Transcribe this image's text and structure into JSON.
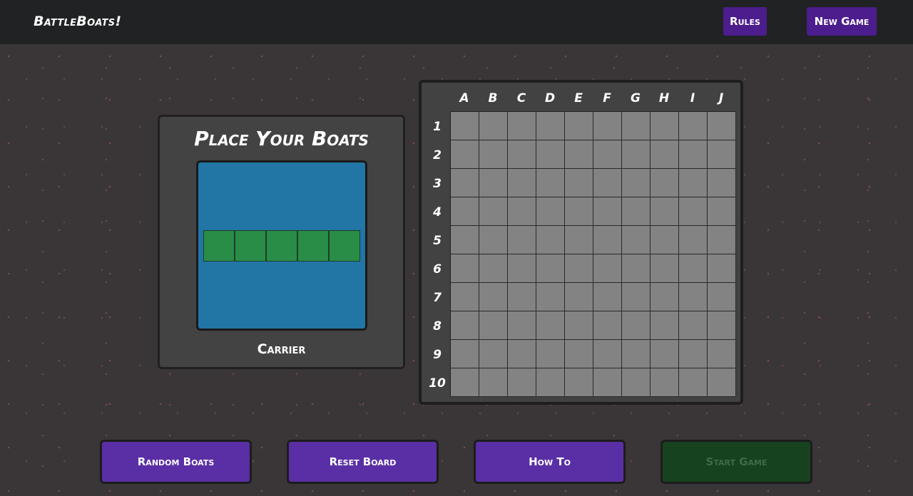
{
  "header": {
    "brand": "BattleBoats!",
    "rules_label": "Rules",
    "new_game_label": "New Game"
  },
  "placer": {
    "title": "Place Your Boats",
    "current_boat": "Carrier",
    "boat_length": 5
  },
  "board": {
    "columns": [
      "A",
      "B",
      "C",
      "D",
      "E",
      "F",
      "G",
      "H",
      "I",
      "J"
    ],
    "rows": [
      "1",
      "2",
      "3",
      "4",
      "5",
      "6",
      "7",
      "8",
      "9",
      "10"
    ]
  },
  "actions": {
    "random_label": "Random Boats",
    "reset_label": "Reset Board",
    "howto_label": "How To",
    "start_label": "Start Game"
  },
  "colors": {
    "topbar": "#212224",
    "nav_button": "#4c1d8c",
    "action_button": "#5a2fa6",
    "start_disabled": "#17421f",
    "water": "#2176a6",
    "boat": "#2a8d47",
    "grid_cell": "#838383"
  }
}
